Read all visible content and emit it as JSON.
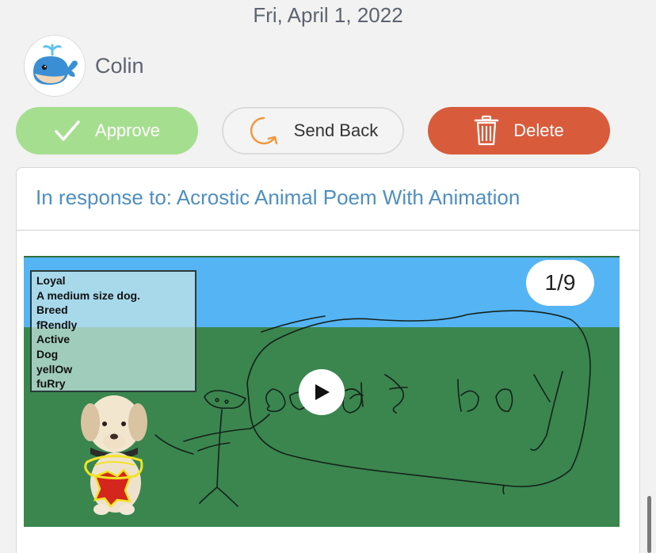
{
  "post": {
    "date": "Fri, April 1, 2022",
    "author": "Colin",
    "avatar_icon": "whale-icon"
  },
  "actions": {
    "approve_label": "Approve",
    "approve_icon": "checkmark-icon",
    "approve_color": "#a6de90",
    "send_back_label": "Send Back",
    "send_back_icon": "redo-arrow-icon",
    "delete_label": "Delete",
    "delete_icon": "trash-icon",
    "delete_color": "#d85c3c"
  },
  "response": {
    "title": "In response to: Acrostic Animal Poem With Animation",
    "title_color": "#4f8fc0"
  },
  "media": {
    "page_counter": "1/9",
    "poem_lines": [
      "Loyal",
      "A medium size dog.",
      "Breed",
      "fRendly",
      "Active",
      "Dog",
      "yellOw",
      "fuRry"
    ],
    "play_icon": "play-icon",
    "sky_color": "#55b4f4",
    "ground_color": "#3a864e"
  }
}
